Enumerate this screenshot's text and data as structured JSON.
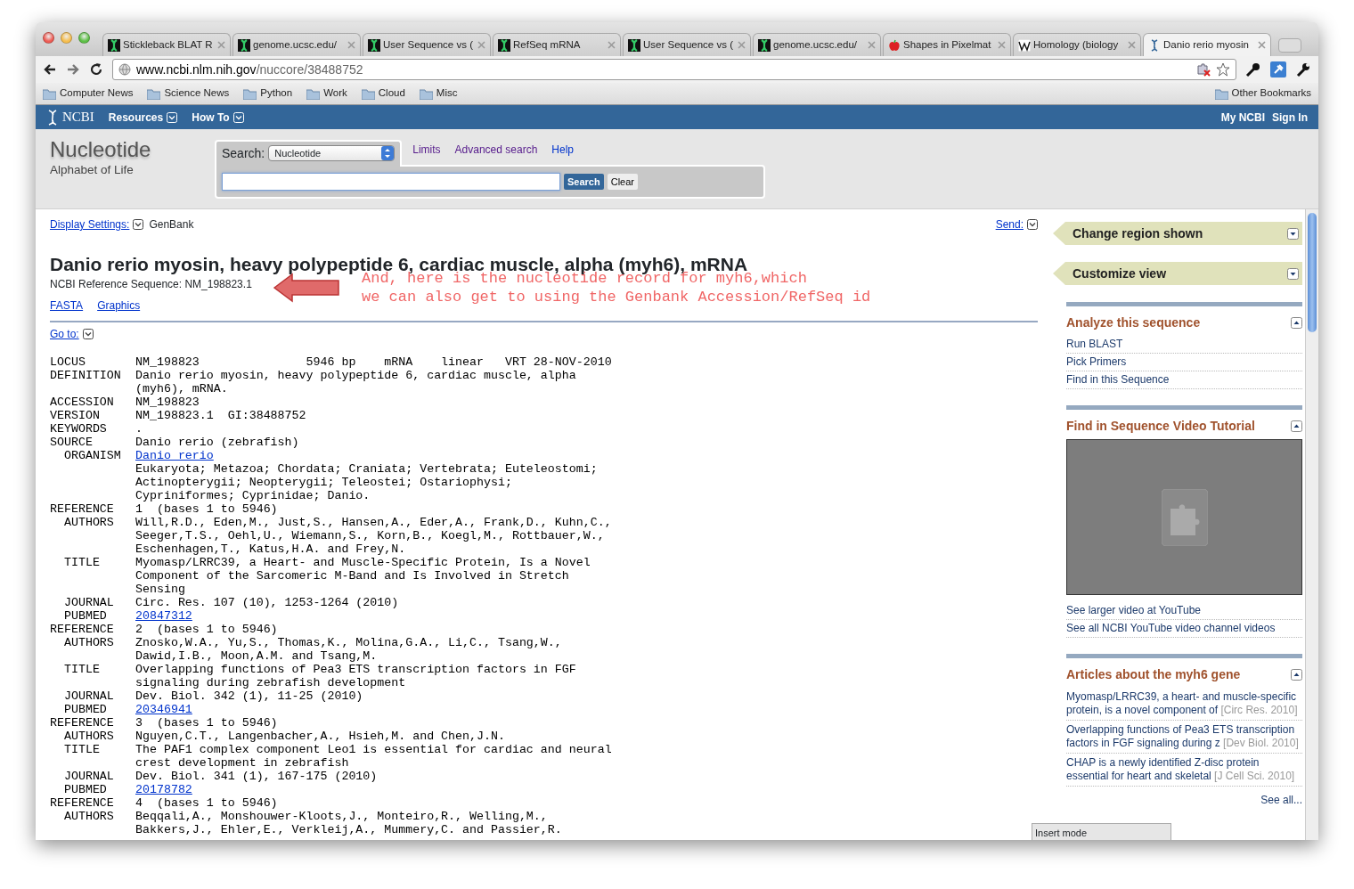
{
  "tabs": [
    {
      "title": "Stickleback BLAT R",
      "kind": "dna",
      "selected": false
    },
    {
      "title": "genome.ucsc.edu/",
      "kind": "dna",
      "selected": false
    },
    {
      "title": "User Sequence vs (",
      "kind": "dna",
      "selected": false
    },
    {
      "title": "RefSeq mRNA",
      "kind": "dna",
      "selected": false
    },
    {
      "title": "User Sequence vs (",
      "kind": "dna",
      "selected": false
    },
    {
      "title": "genome.ucsc.edu/",
      "kind": "dna",
      "selected": false
    },
    {
      "title": "Shapes in Pixelmat",
      "kind": "apple",
      "selected": false
    },
    {
      "title": "Homology (biology",
      "kind": "wiki",
      "selected": false
    },
    {
      "title": "Danio rerio myosin",
      "kind": "ncbi",
      "selected": true
    }
  ],
  "address": {
    "host": "www.ncbi.nlm.nih.gov",
    "path": "/nuccore/38488752"
  },
  "bookmarks": [
    "Computer News",
    "Science News",
    "Python",
    "Work",
    "Cloud",
    "Misc"
  ],
  "other_bookmarks": "Other Bookmarks",
  "ncbi_bar": {
    "logo": "NCBI",
    "menus": [
      "Resources",
      "How To"
    ],
    "account": [
      "My NCBI",
      "Sign In"
    ]
  },
  "db_header": {
    "title": "Nucleotide",
    "subtitle": "Alphabet of Life",
    "search_label": "Search:",
    "database": "Nucleotide",
    "links": [
      "Limits",
      "Advanced search",
      "Help"
    ],
    "search_button": "Search",
    "clear_button": "Clear"
  },
  "display_settings": {
    "label": "Display Settings:",
    "value": "GenBank",
    "send": "Send:"
  },
  "record_title": "Danio rerio myosin, heavy polypeptide 6, cardiac muscle, alpha (myh6), mRNA",
  "reference_sequence": "NCBI Reference Sequence: NM_198823.1",
  "format_links": [
    "FASTA",
    "Graphics"
  ],
  "annotation": [
    "And, here is the nucleotide record for myh6,which",
    "we can also get to using the Genbank Accession/RefSeq id"
  ],
  "goto": "Go to:",
  "record": [
    {
      "key": "LOCUS",
      "kind": "field",
      "lines": [
        "NM_198823               5946 bp    mRNA    linear   VRT 28-NOV-2010"
      ]
    },
    {
      "key": "DEFINITION",
      "kind": "field",
      "lines": [
        "Danio rerio myosin, heavy polypeptide 6, cardiac muscle, alpha",
        "(myh6), mRNA."
      ]
    },
    {
      "key": "ACCESSION",
      "kind": "field",
      "lines": [
        "NM_198823"
      ]
    },
    {
      "key": "VERSION",
      "kind": "field",
      "lines": [
        "NM_198823.1  GI:38488752"
      ]
    },
    {
      "key": "KEYWORDS",
      "kind": "field",
      "lines": [
        "."
      ]
    },
    {
      "key": "SOURCE",
      "kind": "field",
      "lines": [
        "Danio rerio (zebrafish)"
      ]
    },
    {
      "key": "ORGANISM",
      "kind": "subfield",
      "link": true,
      "lines": [
        "Danio rerio",
        "Eukaryota; Metazoa; Chordata; Craniata; Vertebrata; Euteleostomi;",
        "Actinopterygii; Neopterygii; Teleostei; Ostariophysi;",
        "Cypriniformes; Cyprinidae; Danio."
      ]
    },
    {
      "key": "REFERENCE",
      "kind": "field",
      "lines": [
        "1  (bases 1 to 5946)"
      ]
    },
    {
      "key": "AUTHORS",
      "kind": "subfield",
      "lines": [
        "Will,R.D., Eden,M., Just,S., Hansen,A., Eder,A., Frank,D., Kuhn,C.,",
        "Seeger,T.S., Oehl,U., Wiemann,S., Korn,B., Koegl,M., Rottbauer,W.,",
        "Eschenhagen,T., Katus,H.A. and Frey,N."
      ]
    },
    {
      "key": "TITLE",
      "kind": "subfield",
      "lines": [
        "Myomasp/LRRC39, a Heart- and Muscle-Specific Protein, Is a Novel",
        "Component of the Sarcomeric M-Band and Is Involved in Stretch",
        "Sensing"
      ]
    },
    {
      "key": "JOURNAL",
      "kind": "subfield",
      "lines": [
        "Circ. Res. 107 (10), 1253-1264 (2010)"
      ]
    },
    {
      "key": "PUBMED",
      "kind": "subfield",
      "link": true,
      "lines": [
        "20847312"
      ]
    },
    {
      "key": "REFERENCE",
      "kind": "field",
      "lines": [
        "2  (bases 1 to 5946)"
      ]
    },
    {
      "key": "AUTHORS",
      "kind": "subfield",
      "lines": [
        "Znosko,W.A., Yu,S., Thomas,K., Molina,G.A., Li,C., Tsang,W.,",
        "Dawid,I.B., Moon,A.M. and Tsang,M."
      ]
    },
    {
      "key": "TITLE",
      "kind": "subfield",
      "lines": [
        "Overlapping functions of Pea3 ETS transcription factors in FGF",
        "signaling during zebrafish development"
      ]
    },
    {
      "key": "JOURNAL",
      "kind": "subfield",
      "lines": [
        "Dev. Biol. 342 (1), 11-25 (2010)"
      ]
    },
    {
      "key": "PUBMED",
      "kind": "subfield",
      "link": true,
      "lines": [
        "20346941"
      ]
    },
    {
      "key": "REFERENCE",
      "kind": "field",
      "lines": [
        "3  (bases 1 to 5946)"
      ]
    },
    {
      "key": "AUTHORS",
      "kind": "subfield",
      "lines": [
        "Nguyen,C.T., Langenbacher,A., Hsieh,M. and Chen,J.N."
      ]
    },
    {
      "key": "TITLE",
      "kind": "subfield",
      "lines": [
        "The PAF1 complex component Leo1 is essential for cardiac and neural",
        "crest development in zebrafish"
      ]
    },
    {
      "key": "JOURNAL",
      "kind": "subfield",
      "lines": [
        "Dev. Biol. 341 (1), 167-175 (2010)"
      ]
    },
    {
      "key": "PUBMED",
      "kind": "subfield",
      "link": true,
      "lines": [
        "20178782"
      ]
    },
    {
      "key": "REFERENCE",
      "kind": "field",
      "lines": [
        "4  (bases 1 to 5946)"
      ]
    },
    {
      "key": "AUTHORS",
      "kind": "subfield",
      "lines": [
        "Beqqali,A., Monshouwer-Kloots,J., Monteiro,R., Welling,M.,",
        "Bakkers,J., Ehler,E., Verkleij,A., Mummery,C. and Passier,R."
      ]
    }
  ],
  "sidebar": [
    {
      "title": "Change region shown",
      "kind": "tab",
      "expanded": false
    },
    {
      "title": "Customize view",
      "kind": "tab",
      "expanded": false
    },
    {
      "title": "Analyze this sequence",
      "kind": "section",
      "expanded": true,
      "links": [
        "Run BLAST",
        "Pick Primers",
        "Find in this Sequence"
      ]
    },
    {
      "title": "Find in Sequence Video Tutorial",
      "kind": "video",
      "expanded": true,
      "links": [
        "See larger video at YouTube",
        "See all NCBI YouTube video channel videos"
      ]
    },
    {
      "title": "Articles about the myh6 gene",
      "kind": "articles",
      "expanded": true,
      "articles": [
        {
          "title": "Myomasp/LRRC39, a heart- and muscle-specific protein, is a novel component of",
          "citation": "[Circ Res. 2010]"
        },
        {
          "title": "Overlapping functions of Pea3 ETS transcription factors in FGF signaling during z",
          "citation": "[Dev Biol. 2010]"
        },
        {
          "title": "CHAP is a newly identified Z-disc protein essential for heart and skeletal",
          "citation": "[J Cell Sci. 2010]"
        }
      ],
      "see_all": "See all..."
    }
  ],
  "status": "Insert mode"
}
